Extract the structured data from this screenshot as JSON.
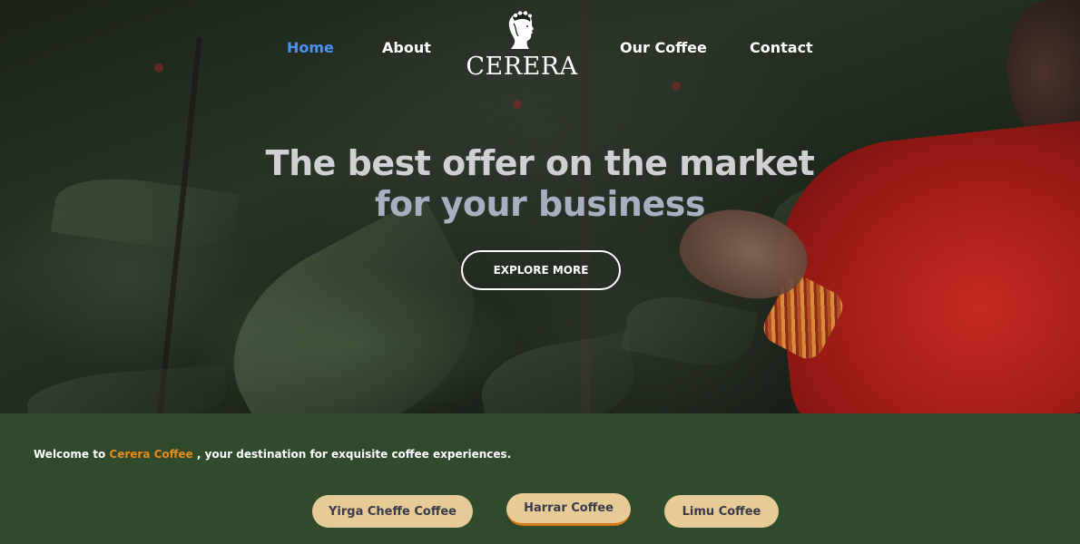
{
  "nav": {
    "items": [
      {
        "label": "Home",
        "active": true
      },
      {
        "label": "About"
      },
      {
        "label": "Our Coffee"
      },
      {
        "label": "Contact"
      }
    ]
  },
  "logo": {
    "text": "CERERA",
    "icon": "goddess-head-icon"
  },
  "hero": {
    "headline_line1": "The best offer on the market",
    "headline_line2": "for your business",
    "cta_label": "EXPLORE MORE"
  },
  "welcome": {
    "prefix": "Welcome to ",
    "brand": "Cerera Coffee",
    "suffix": " , your destination for exquisite coffee experiences."
  },
  "coffees": [
    {
      "label": "Yirga Cheffe Coffee"
    },
    {
      "label": "Harrar Coffee",
      "selected": true
    },
    {
      "label": "Limu Coffee"
    }
  ],
  "colors": {
    "nav_active": "#4a90f5",
    "brand_accent": "#e98b1b",
    "section_bg": "#2f4a2d",
    "pill_bg": "#e7cb96"
  }
}
